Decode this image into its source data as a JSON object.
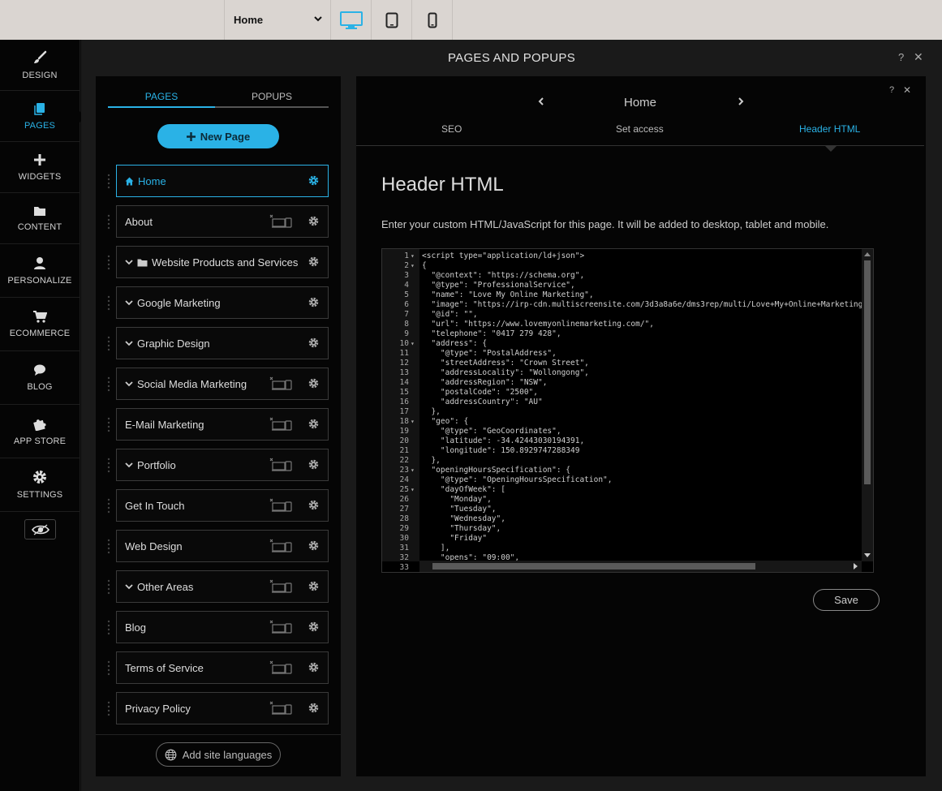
{
  "topbar": {
    "page_select": "Home",
    "device_icons": [
      "desktop-icon",
      "tablet-icon",
      "mobile-icon"
    ],
    "active_device": "desktop"
  },
  "left_nav": {
    "items": [
      {
        "label": "DESIGN",
        "icon": "brush-icon"
      },
      {
        "label": "PAGES",
        "icon": "pages-icon",
        "active": true
      },
      {
        "label": "WIDGETS",
        "icon": "plus-icon"
      },
      {
        "label": "CONTENT",
        "icon": "folder-icon"
      },
      {
        "label": "PERSONALIZE",
        "icon": "person-icon"
      },
      {
        "label": "ECOMMERCE",
        "icon": "cart-icon"
      },
      {
        "label": "BLOG",
        "icon": "chat-icon"
      },
      {
        "label": "APP STORE",
        "icon": "puzzle-icon"
      },
      {
        "label": "SETTINGS",
        "icon": "gear-icon"
      }
    ],
    "preview_icon": "eye-icon"
  },
  "main": {
    "title": "PAGES AND POPUPS",
    "help": "?",
    "close": "✕"
  },
  "pages_panel": {
    "tabs": [
      "PAGES",
      "POPUPS"
    ],
    "new_page_label": "New Page",
    "pages": [
      {
        "name": "Home",
        "active": true,
        "home": true,
        "chevron": false,
        "folder": false,
        "hidden": false
      },
      {
        "name": "About",
        "chevron": false,
        "folder": false,
        "hidden": true
      },
      {
        "name": "Website Products and Services",
        "chevron": true,
        "folder": true,
        "hidden": false
      },
      {
        "name": "Google Marketing",
        "chevron": true,
        "folder": false,
        "hidden": false
      },
      {
        "name": "Graphic Design",
        "chevron": true,
        "folder": false,
        "hidden": false
      },
      {
        "name": "Social Media Marketing",
        "chevron": true,
        "folder": false,
        "hidden": true
      },
      {
        "name": "E-Mail Marketing",
        "chevron": false,
        "folder": false,
        "hidden": true
      },
      {
        "name": "Portfolio",
        "chevron": true,
        "folder": false,
        "hidden": true
      },
      {
        "name": "Get In Touch",
        "chevron": false,
        "folder": false,
        "hidden": true
      },
      {
        "name": "Web Design",
        "chevron": false,
        "folder": false,
        "hidden": true
      },
      {
        "name": "Other Areas",
        "chevron": true,
        "folder": false,
        "hidden": true
      },
      {
        "name": "Blog",
        "chevron": false,
        "folder": false,
        "hidden": true
      },
      {
        "name": "Terms of Service",
        "chevron": false,
        "folder": false,
        "hidden": true
      },
      {
        "name": "Privacy Policy",
        "chevron": false,
        "folder": false,
        "hidden": true
      }
    ],
    "add_languages_label": "Add site languages"
  },
  "right_panel": {
    "page_title": "Home",
    "help": "?",
    "close": "✕",
    "tabs": [
      "SEO",
      "Set access",
      "Header HTML"
    ],
    "active_tab": "Header HTML",
    "heading": "Header HTML",
    "description": "Enter your custom HTML/JavaScript for this page. It will be added to desktop, tablet and mobile.",
    "save_label": "Save",
    "code_lines": [
      {
        "n": "1",
        "fold": true,
        "text": "<script type=\"application/ld+json\">"
      },
      {
        "n": "2",
        "fold": true,
        "text": "{"
      },
      {
        "n": "3",
        "fold": false,
        "text": "  \"@context\": \"https://schema.org\","
      },
      {
        "n": "4",
        "fold": false,
        "text": "  \"@type\": \"ProfessionalService\","
      },
      {
        "n": "5",
        "fold": false,
        "text": "  \"name\": \"Love My Online Marketing\","
      },
      {
        "n": "6",
        "fold": false,
        "text": "  \"image\": \"https://irp-cdn.multiscreensite.com/3d3a8a6e/dms3rep/multi/Love+My+Online+Marketing"
      },
      {
        "n": "7",
        "fold": false,
        "text": "  \"@id\": \"\","
      },
      {
        "n": "8",
        "fold": false,
        "text": "  \"url\": \"https://www.lovemyonlinemarketing.com/\","
      },
      {
        "n": "9",
        "fold": false,
        "text": "  \"telephone\": \"0417 279 428\","
      },
      {
        "n": "10",
        "fold": true,
        "text": "  \"address\": {"
      },
      {
        "n": "11",
        "fold": false,
        "text": "    \"@type\": \"PostalAddress\","
      },
      {
        "n": "12",
        "fold": false,
        "text": "    \"streetAddress\": \"Crown Street\","
      },
      {
        "n": "13",
        "fold": false,
        "text": "    \"addressLocality\": \"Wollongong\","
      },
      {
        "n": "14",
        "fold": false,
        "text": "    \"addressRegion\": \"NSW\","
      },
      {
        "n": "15",
        "fold": false,
        "text": "    \"postalCode\": \"2500\","
      },
      {
        "n": "16",
        "fold": false,
        "text": "    \"addressCountry\": \"AU\""
      },
      {
        "n": "17",
        "fold": false,
        "text": "  },"
      },
      {
        "n": "18",
        "fold": true,
        "text": "  \"geo\": {"
      },
      {
        "n": "19",
        "fold": false,
        "text": "    \"@type\": \"GeoCoordinates\","
      },
      {
        "n": "20",
        "fold": false,
        "text": "    \"latitude\": -34.42443030194391,"
      },
      {
        "n": "21",
        "fold": false,
        "text": "    \"longitude\": 150.8929747288349"
      },
      {
        "n": "22",
        "fold": false,
        "text": "  },"
      },
      {
        "n": "23",
        "fold": true,
        "text": "  \"openingHoursSpecification\": {"
      },
      {
        "n": "24",
        "fold": false,
        "text": "    \"@type\": \"OpeningHoursSpecification\","
      },
      {
        "n": "25",
        "fold": true,
        "text": "    \"dayOfWeek\": ["
      },
      {
        "n": "26",
        "fold": false,
        "text": "      \"Monday\","
      },
      {
        "n": "27",
        "fold": false,
        "text": "      \"Tuesday\","
      },
      {
        "n": "28",
        "fold": false,
        "text": "      \"Wednesday\","
      },
      {
        "n": "29",
        "fold": false,
        "text": "      \"Thursday\","
      },
      {
        "n": "30",
        "fold": false,
        "text": "      \"Friday\""
      },
      {
        "n": "31",
        "fold": false,
        "text": "    ],"
      },
      {
        "n": "32",
        "fold": false,
        "text": "    \"opens\": \"09:00\","
      },
      {
        "n": "33",
        "fold": false,
        "text": ""
      }
    ]
  },
  "colors": {
    "accent": "#2ab2e6",
    "panel_bg": "#050505",
    "main_bg": "#1a1a1a",
    "topbar_bg": "#dad5d1"
  }
}
